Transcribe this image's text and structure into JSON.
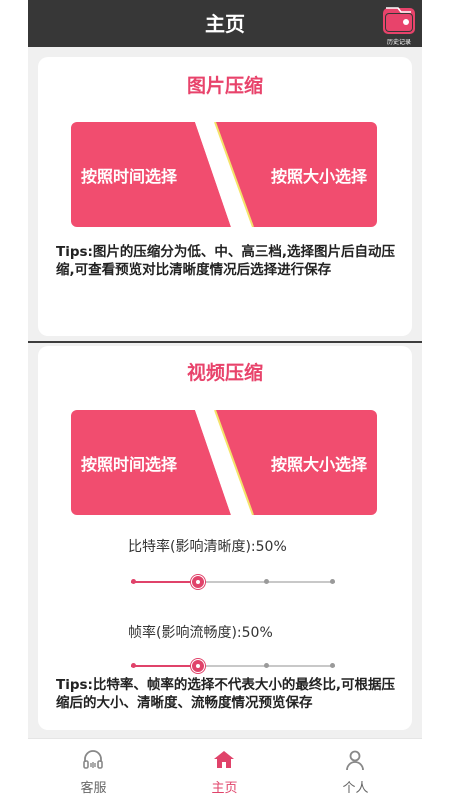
{
  "header": {
    "title": "主页",
    "history_label": "历史记录"
  },
  "image_card": {
    "title": "图片压缩",
    "btn_time": "按照时间选择",
    "btn_size": "按照大小选择",
    "tips": "Tips:图片的压缩分为低、中、高三档,选择图片后自动压缩,可查看预览对比清晰度情况后选择进行保存"
  },
  "video_card": {
    "title": "视频压缩",
    "btn_time": "按照时间选择",
    "btn_size": "按照大小选择",
    "bitrate_label": "比特率(影响清晰度):50%",
    "bitrate_value": 0.5,
    "framerate_label": "帧率(影响流畅度):50%",
    "framerate_value": 0.5,
    "tips": "Tips:比特率、帧率的选择不代表大小的最终比,可根据压缩后的大小、清晰度、流畅度情况预览保存"
  },
  "tabs": [
    {
      "label": "客服",
      "icon": "headset-icon",
      "active": false
    },
    {
      "label": "主页",
      "icon": "home-icon",
      "active": true
    },
    {
      "label": "个人",
      "icon": "person-icon",
      "active": false
    }
  ],
  "colors": {
    "accent": "#e8436b",
    "header": "#373737",
    "button": "#f14d6f"
  }
}
